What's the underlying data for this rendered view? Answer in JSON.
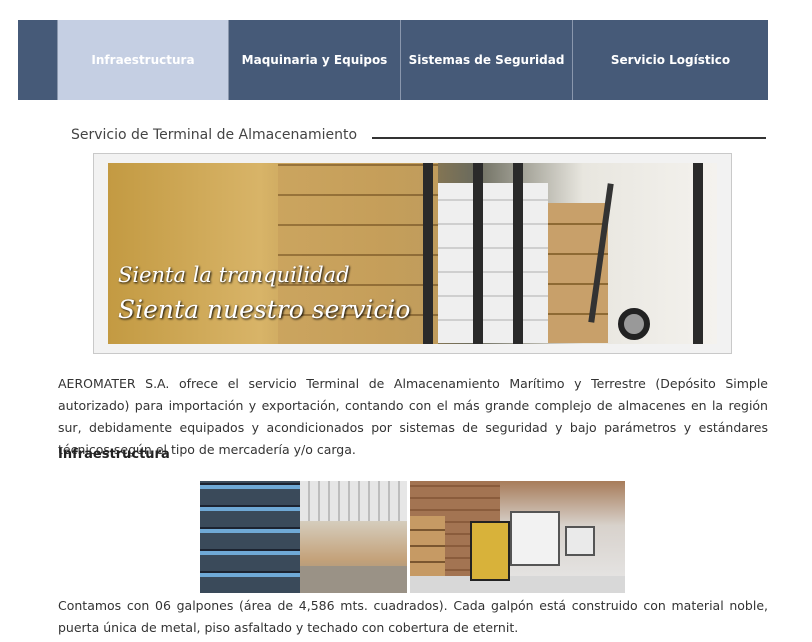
{
  "nav": {
    "items": [
      {
        "label": "Infraestructura",
        "active": true
      },
      {
        "label": "Maquinaria y Equipos",
        "active": false
      },
      {
        "label": "Sistemas de Seguridad",
        "active": false
      },
      {
        "label": "Servicio Logístico",
        "active": false
      }
    ]
  },
  "section": {
    "title": "Servicio de Terminal de Almacenamiento"
  },
  "banner": {
    "line1": "Sienta la tranquilidad",
    "line2": "Sienta nuestro servicio"
  },
  "content": {
    "intro": "AEROMATER S.A. ofrece el servicio Terminal de Almacenamiento Marítimo y Terrestre (Depósito Simple autorizado) para importación y exportación, contando con el más grande complejo de almacenes en la región sur, debidamente equipados y acondicionados por sistemas de seguridad y bajo parámetros y estándares técnicos según el tipo de mercadería y/o carga.",
    "subheading": "Infraestructura",
    "infra_text": "Contamos con 06 galpones (área de 4,586 mts. cuadrados). Cada galpón está construido con material noble, puerta única de metal, piso asfaltado y techado con cobertura de eternit."
  },
  "colors": {
    "nav_bg": "#465a78",
    "nav_active": "#c5cfe3"
  }
}
